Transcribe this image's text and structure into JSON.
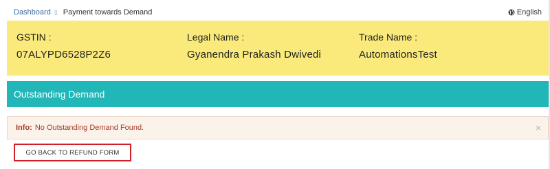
{
  "breadcrumb": {
    "home": "Dashboard",
    "separator": "▯",
    "current": "Payment towards Demand"
  },
  "language": {
    "label": "English",
    "icon": "globe-icon"
  },
  "taxpayer": {
    "gstin_label": "GSTIN :",
    "gstin_value": "07ALYPD6528P2Z6",
    "legal_name_label": "Legal Name :",
    "legal_name_value": "Gyanendra Prakash Dwivedi",
    "trade_name_label": "Trade Name :",
    "trade_name_value": "AutomationsTest"
  },
  "section": {
    "title": "Outstanding Demand"
  },
  "alert": {
    "prefix": "Info:",
    "message": "No Outstanding Demand Found.",
    "close_symbol": "×"
  },
  "actions": {
    "back_label": "GO BACK TO REFUND FORM"
  },
  "colors": {
    "info_panel_bg": "#faea7c",
    "section_header_bg": "#21b6b8",
    "alert_text": "#a33a2e",
    "button_highlight": "#d21f26"
  }
}
